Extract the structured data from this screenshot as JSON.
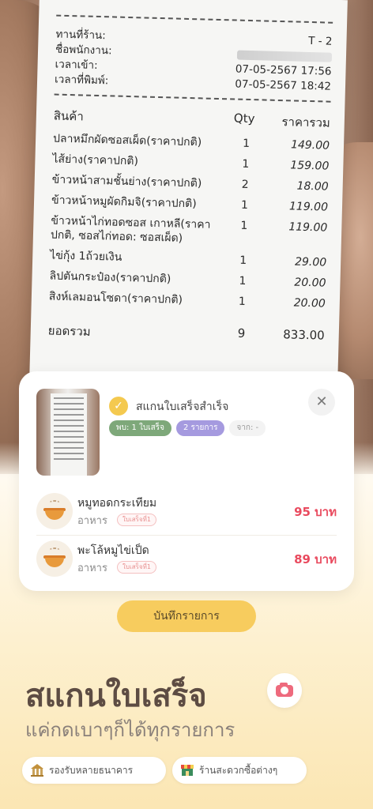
{
  "receipt": {
    "header_rows": [
      {
        "label": "ทานที่ร้าน:",
        "value": "T - 2"
      },
      {
        "label": "ชื่อพนักงาน:",
        "value": ""
      },
      {
        "label": "เวลาเข้า:",
        "value": "07-05-2567 17:56"
      },
      {
        "label": "เวลาที่พิมพ์:",
        "value": "07-05-2567 18:42"
      }
    ],
    "columns": {
      "product": "สินค้า",
      "qty": "Qty",
      "total": "ราคารวม"
    },
    "items": [
      {
        "name": "ปลาหมึกผัดซอสเผ็ด(ราคาปกติ)",
        "qty": "1",
        "price": "149.00"
      },
      {
        "name": "ไส้ย่าง(ราคาปกติ)",
        "qty": "1",
        "price": "159.00"
      },
      {
        "name": "ข้าวหน้าสามชั้นย่าง(ราคาปกติ)",
        "qty": "2",
        "price": "18.00"
      },
      {
        "name": "ข้าวหน้าหมูผัดกิมจิ(ราคาปกติ)",
        "qty": "1",
        "price": "119.00"
      },
      {
        "name": "ข้าวหน้าไก่ทอดซอส เกาหลี(ราคาปกติ, ซอสไก่ทอด: ซอสเผ็ด)",
        "qty": "1",
        "price": "119.00"
      },
      {
        "name": "ไข่กุ้ง 1ถ้วยเงิน",
        "qty": "1",
        "price": "29.00"
      },
      {
        "name": "ลิปตันกระป๋อง(ราคาปกติ)",
        "qty": "1",
        "price": "20.00"
      },
      {
        "name": "สิงห์เลมอนโซดา(ราคาปกติ)",
        "qty": "1",
        "price": "20.00"
      }
    ],
    "total": {
      "label": "ยอดรวม",
      "qty": "9",
      "price": "833.00"
    }
  },
  "card": {
    "title": "สแกนใบเสร็จสำเร็จ",
    "badges": [
      "พบ: 1 ใบเสร็จ",
      "2 รายการ",
      "จาก: -"
    ],
    "items": [
      {
        "name": "หมูทอดกระเทียม",
        "category": "อาหาร",
        "tag": "ใบเสร็จที่1",
        "price": "95 บาท"
      },
      {
        "name": "พะโล้หมูไข่เป็ด",
        "category": "อาหาร",
        "tag": "ใบเสร็จที่1",
        "price": "89 บาท"
      }
    ]
  },
  "save_button": "บันทึกรายการ",
  "headline": "สแกนใบเสร็จ",
  "subline": "แค่กดเบาๆก็ได้ทุกรายการ",
  "features": [
    "รองรับหลายธนาคาร",
    "ร้านสะดวกซื้อต่างๆ"
  ],
  "icons": {
    "check": "check-icon",
    "close": "close-icon",
    "camera": "camera-icon",
    "bank": "bank-icon",
    "store": "store-icon",
    "food": "bowl-icon"
  },
  "colors": {
    "accent": "#f7cc5e",
    "price": "#e94a5e",
    "headline": "#5d4c43"
  }
}
